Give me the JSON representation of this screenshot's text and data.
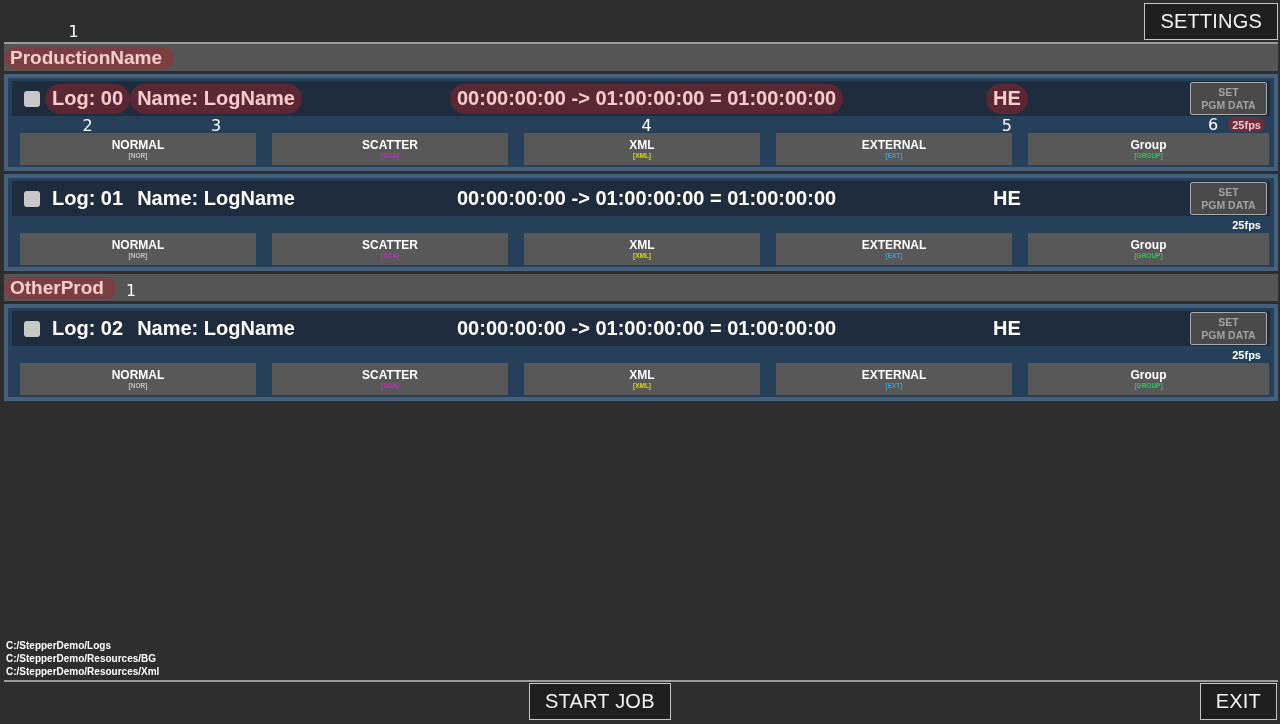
{
  "settings_button": {
    "label": "SETTINGS"
  },
  "productions": [
    {
      "name": {
        "text": "ProductionName",
        "highlighted": true,
        "callout": {
          "text": "1",
          "kind": "above"
        }
      },
      "logs": [
        {
          "checked": false,
          "log": {
            "text": "Log: 00",
            "highlighted": true,
            "callout": {
              "text": "2",
              "kind": "below"
            }
          },
          "name": {
            "text": "Name: LogName",
            "highlighted": true,
            "callout": {
              "text": "3",
              "kind": "below"
            }
          },
          "timecode": {
            "text": "00:00:00:00 -> 01:00:00:00 = 01:00:00:00",
            "highlighted": true,
            "callout": {
              "text": "4",
              "kind": "below"
            }
          },
          "standard": {
            "text": "HE",
            "highlighted": true,
            "callout": {
              "text": "5",
              "kind": "below"
            }
          },
          "set_button": {
            "label": "SET\nPGM DATA",
            "disabled": true
          },
          "fps": {
            "text": "25fps",
            "highlighted": true,
            "callout": {
              "text": "6",
              "kind": "left"
            }
          },
          "modes": [
            {
              "label": "NORMAL",
              "tag": "[NOR]",
              "color": "#c4c4c4"
            },
            {
              "label": "SCATTER",
              "tag": "[SCA]",
              "color": "#c42cc4"
            },
            {
              "label": "XML",
              "tag": "[XML]",
              "color": "#d8d820"
            },
            {
              "label": "EXTERNAL",
              "tag": "[EXT]",
              "color": "#2ea8d8"
            },
            {
              "label": "Group",
              "tag": "[GROUP]",
              "color": "#24cc58"
            }
          ]
        },
        {
          "checked": false,
          "log": {
            "text": "Log: 01",
            "highlighted": false
          },
          "name": {
            "text": "Name: LogName",
            "highlighted": false
          },
          "timecode": {
            "text": "00:00:00:00 -> 01:00:00:00 = 01:00:00:00",
            "highlighted": false
          },
          "standard": {
            "text": "HE",
            "highlighted": false
          },
          "set_button": {
            "label": "SET\nPGM DATA",
            "disabled": true
          },
          "fps": {
            "text": "25fps",
            "highlighted": false
          },
          "modes": [
            {
              "label": "NORMAL",
              "tag": "[NOR]",
              "color": "#c4c4c4"
            },
            {
              "label": "SCATTER",
              "tag": "[SCA]",
              "color": "#c42cc4"
            },
            {
              "label": "XML",
              "tag": "[XML]",
              "color": "#d8d820"
            },
            {
              "label": "EXTERNAL",
              "tag": "[EXT]",
              "color": "#2ea8d8"
            },
            {
              "label": "Group",
              "tag": "[GROUP]",
              "color": "#24cc58"
            }
          ]
        }
      ]
    },
    {
      "name": {
        "text": "OtherProd",
        "highlighted": true,
        "callout": {
          "text": "1",
          "kind": "right"
        }
      },
      "logs": [
        {
          "checked": false,
          "log": {
            "text": "Log: 02",
            "highlighted": false
          },
          "name": {
            "text": "Name: LogName",
            "highlighted": false
          },
          "timecode": {
            "text": "00:00:00:00 -> 01:00:00:00 = 01:00:00:00",
            "highlighted": false
          },
          "standard": {
            "text": "HE",
            "highlighted": false
          },
          "set_button": {
            "label": "SET\nPGM DATA",
            "disabled": true
          },
          "fps": {
            "text": "25fps",
            "highlighted": false
          },
          "modes": [
            {
              "label": "NORMAL",
              "tag": "[NOR]",
              "color": "#c4c4c4"
            },
            {
              "label": "SCATTER",
              "tag": "[SCA]",
              "color": "#c42cc4"
            },
            {
              "label": "XML",
              "tag": "[XML]",
              "color": "#d8d820"
            },
            {
              "label": "EXTERNAL",
              "tag": "[EXT]",
              "color": "#2ea8d8"
            },
            {
              "label": "Group",
              "tag": "[GROUP]",
              "color": "#24cc58"
            }
          ]
        }
      ]
    }
  ],
  "paths": [
    "C:/StepperDemo/Logs",
    "C:/StepperDemo/Resources/BG",
    "C:/StepperDemo/Resources/Xml"
  ],
  "start_job_button": {
    "label": "START JOB"
  },
  "exit_button": {
    "label": "EXIT"
  }
}
